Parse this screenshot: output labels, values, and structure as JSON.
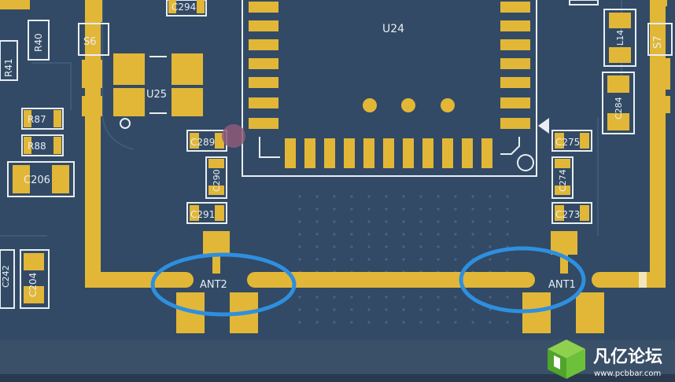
{
  "board": {
    "colors": {
      "substrate": "#2f4660",
      "copper": "#e2b737",
      "silkscreen": "#e8eef4",
      "highlight_ellipse": "#2e8fe0",
      "via_marker": "#8e5a78"
    },
    "components": {
      "u24": "U24",
      "u25": "U25",
      "s6": "S6",
      "s7": "S7",
      "r40": "R40",
      "r41": "R41",
      "r87": "R87",
      "r88": "R88",
      "c206": "C206",
      "c204": "C204",
      "c242": "C242",
      "c289": "C289",
      "c290": "C290",
      "c291": "C291",
      "c294": "C294",
      "c275": "C275",
      "c274": "C274",
      "c273": "C273",
      "l14": "L14",
      "c284": "C284"
    },
    "antennas": {
      "ant2": "ANT2",
      "ant1": "ANT1"
    },
    "highlights": [
      "ANT2",
      "ANT1"
    ]
  },
  "watermark": {
    "site_name": "凡亿论坛",
    "url": "www.pcbbar.com",
    "logo_icon": "cube-logo-icon"
  }
}
